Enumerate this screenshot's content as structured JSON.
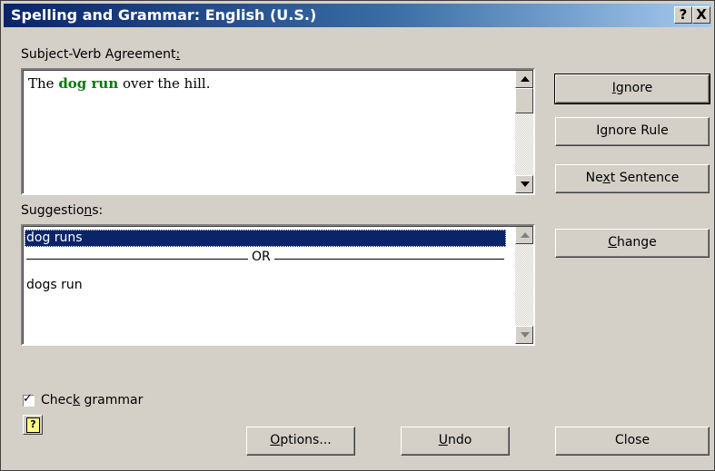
{
  "window": {
    "title": "Spelling and Grammar: English (U.S.)",
    "help_glyph": "?",
    "close_glyph": "X"
  },
  "error_label": {
    "text": "Subject-Verb Agreement",
    "accel": ":"
  },
  "sentence": {
    "before": "The ",
    "error": "dog run",
    "after": " over the hill.",
    "error_color": "#0a7a0a"
  },
  "suggestions_label": {
    "before": "Suggestio",
    "accel": "n",
    "after": "s:"
  },
  "suggestions": {
    "items": [
      "dog runs",
      "dogs run"
    ],
    "separator": "OR",
    "selected_index": 0
  },
  "buttons": {
    "ignore": {
      "accel": "I",
      "rest": "gnore"
    },
    "ignore_rule": {
      "before": "I",
      "accel": "g",
      "after": "nore Rule"
    },
    "next_sentence": {
      "before": "Ne",
      "accel": "x",
      "after": "t Sentence"
    },
    "change": {
      "accel": "C",
      "rest": "hange"
    },
    "options": {
      "accel": "O",
      "rest": "ptions..."
    },
    "undo": {
      "accel": "U",
      "rest": "ndo"
    },
    "close": "Close"
  },
  "check_grammar": {
    "before": "Chec",
    "accel": "k",
    "after": " grammar",
    "checked": true
  },
  "icons": {
    "help": "help-icon",
    "scroll_up": "up-arrow-icon",
    "scroll_down": "down-arrow-icon",
    "check": "checkmark-icon"
  },
  "colors": {
    "titlebar_start": "#0a246a",
    "titlebar_end": "#a6caf0",
    "face": "#d4d0c8",
    "selection": "#0a246a"
  }
}
